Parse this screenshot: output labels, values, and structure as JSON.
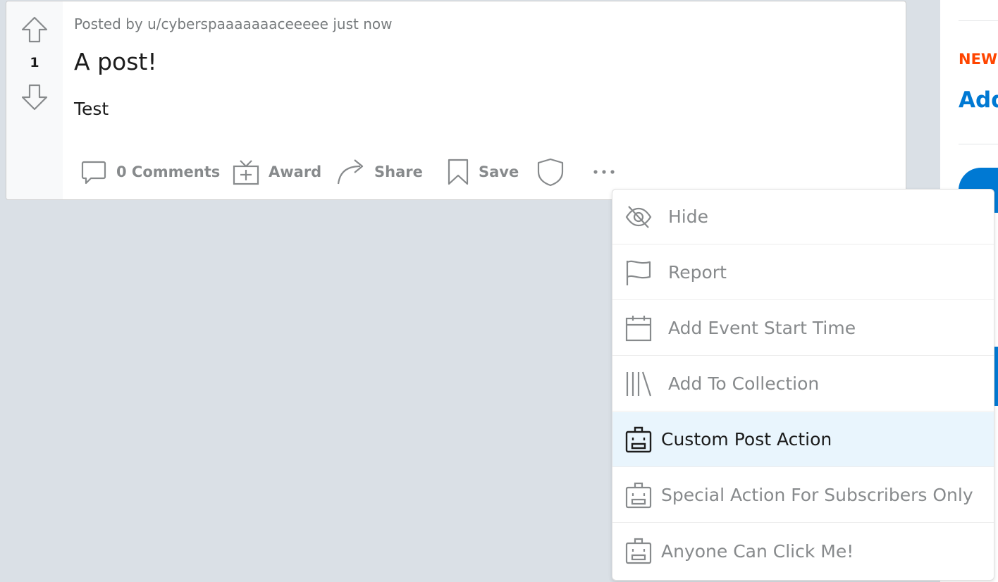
{
  "post": {
    "score": "1",
    "meta": "Posted by u/cyberspaaaaaaaceeeee just now",
    "title": "A post!",
    "body": "Test",
    "actions": {
      "comments": "0 Comments",
      "award": "Award",
      "share": "Share",
      "save": "Save"
    }
  },
  "sidebar": {
    "new_label": "NEW",
    "add_label": "Add"
  },
  "menu": {
    "items": [
      {
        "label": "Hide",
        "icon": "eye-slash-icon"
      },
      {
        "label": "Report",
        "icon": "flag-icon"
      },
      {
        "label": "Add Event Start Time",
        "icon": "calendar-icon"
      },
      {
        "label": "Add To Collection",
        "icon": "collection-icon"
      },
      {
        "label": "Custom Post Action",
        "icon": "bot-icon",
        "highlighted": true
      },
      {
        "label": "Special Action For Subscribers Only",
        "icon": "bot-icon"
      },
      {
        "label": "Anyone Can Click Me!",
        "icon": "bot-icon"
      }
    ]
  },
  "colors": {
    "page_bg": "#dae0e6",
    "accent_blue": "#0079d3",
    "new_orange": "#ff4500",
    "muted_gray": "#878a8c",
    "highlight_bg": "#e9f5fd"
  }
}
